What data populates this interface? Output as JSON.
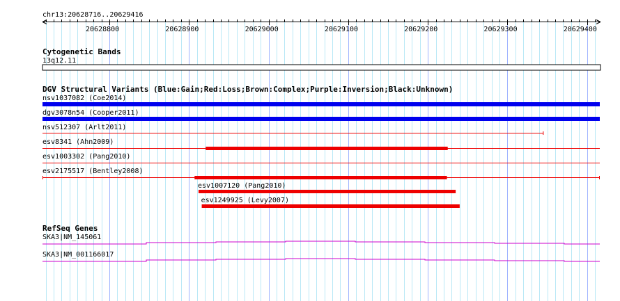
{
  "locus": "chr13:20628716..20629416",
  "scale": {
    "start": 20628716,
    "end": 20629416,
    "ticks": [
      "20628800",
      "20628900",
      "20629000",
      "20629100",
      "20629200",
      "20629300",
      "20629400"
    ]
  },
  "tracks": {
    "cytoband": {
      "title": "Cytogenetic Bands",
      "band": "13q12.11"
    },
    "dgv": {
      "title": "DGV Structural Variants (Blue:Gain;Red:Loss;Brown:Complex;Purple:Inversion;Black:Unknown)",
      "colors": {
        "gain": "#0000ee",
        "loss": "#ee0000"
      },
      "features": [
        {
          "label": "nsv1037082 (Coe2014)",
          "type": "gain",
          "start": 20628716,
          "end": 20629416,
          "style": "thick"
        },
        {
          "label": "dgv3078n54 (Cooper2011)",
          "type": "gain",
          "start": 20628716,
          "end": 20629416,
          "style": "thick"
        },
        {
          "label": "nsv512307 (Arlt2011)",
          "type": "loss",
          "start": 20628716,
          "end": 20629345,
          "style": "thin-end"
        },
        {
          "label": "esv8341 (Ahn2009)",
          "type": "loss",
          "start": 20628716,
          "end": 20629416,
          "style": "thin",
          "thick_start": 20628921,
          "thick_end": 20629225
        },
        {
          "label": "esv1003302 (Pang2010)",
          "type": "loss",
          "start": 20628716,
          "end": 20629416,
          "style": "thin"
        },
        {
          "label": "esv2175517 (Bentley2008)",
          "type": "loss",
          "start": 20628716,
          "end": 20629416,
          "style": "thin-both",
          "thick_start": 20628907,
          "thick_end": 20629224
        },
        {
          "label": "esv1007120 (Pang2010)",
          "type": "loss",
          "start": 20628912,
          "end": 20629235,
          "style": "thick-labelled"
        },
        {
          "label": "esv1249925 (Levy2007)",
          "type": "loss",
          "start": 20628916,
          "end": 20629240,
          "style": "thick-labelled"
        }
      ]
    },
    "refseq": {
      "title": "RefSeq Genes",
      "color": "#cc00cc",
      "genes": [
        {
          "label": "SKA3|NM_145061"
        },
        {
          "label": "SKA3|NM_001166017"
        }
      ]
    }
  }
}
